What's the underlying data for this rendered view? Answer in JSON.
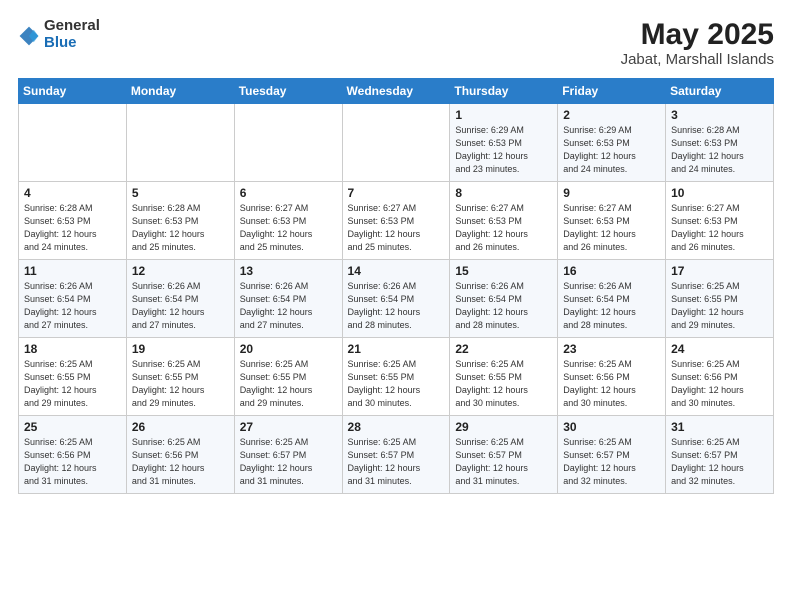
{
  "header": {
    "logo_general": "General",
    "logo_blue": "Blue",
    "month": "May 2025",
    "location": "Jabat, Marshall Islands"
  },
  "weekdays": [
    "Sunday",
    "Monday",
    "Tuesday",
    "Wednesday",
    "Thursday",
    "Friday",
    "Saturday"
  ],
  "weeks": [
    [
      {
        "day": "",
        "info": ""
      },
      {
        "day": "",
        "info": ""
      },
      {
        "day": "",
        "info": ""
      },
      {
        "day": "",
        "info": ""
      },
      {
        "day": "1",
        "info": "Sunrise: 6:29 AM\nSunset: 6:53 PM\nDaylight: 12 hours\nand 23 minutes."
      },
      {
        "day": "2",
        "info": "Sunrise: 6:29 AM\nSunset: 6:53 PM\nDaylight: 12 hours\nand 24 minutes."
      },
      {
        "day": "3",
        "info": "Sunrise: 6:28 AM\nSunset: 6:53 PM\nDaylight: 12 hours\nand 24 minutes."
      }
    ],
    [
      {
        "day": "4",
        "info": "Sunrise: 6:28 AM\nSunset: 6:53 PM\nDaylight: 12 hours\nand 24 minutes."
      },
      {
        "day": "5",
        "info": "Sunrise: 6:28 AM\nSunset: 6:53 PM\nDaylight: 12 hours\nand 25 minutes."
      },
      {
        "day": "6",
        "info": "Sunrise: 6:27 AM\nSunset: 6:53 PM\nDaylight: 12 hours\nand 25 minutes."
      },
      {
        "day": "7",
        "info": "Sunrise: 6:27 AM\nSunset: 6:53 PM\nDaylight: 12 hours\nand 25 minutes."
      },
      {
        "day": "8",
        "info": "Sunrise: 6:27 AM\nSunset: 6:53 PM\nDaylight: 12 hours\nand 26 minutes."
      },
      {
        "day": "9",
        "info": "Sunrise: 6:27 AM\nSunset: 6:53 PM\nDaylight: 12 hours\nand 26 minutes."
      },
      {
        "day": "10",
        "info": "Sunrise: 6:27 AM\nSunset: 6:53 PM\nDaylight: 12 hours\nand 26 minutes."
      }
    ],
    [
      {
        "day": "11",
        "info": "Sunrise: 6:26 AM\nSunset: 6:54 PM\nDaylight: 12 hours\nand 27 minutes."
      },
      {
        "day": "12",
        "info": "Sunrise: 6:26 AM\nSunset: 6:54 PM\nDaylight: 12 hours\nand 27 minutes."
      },
      {
        "day": "13",
        "info": "Sunrise: 6:26 AM\nSunset: 6:54 PM\nDaylight: 12 hours\nand 27 minutes."
      },
      {
        "day": "14",
        "info": "Sunrise: 6:26 AM\nSunset: 6:54 PM\nDaylight: 12 hours\nand 28 minutes."
      },
      {
        "day": "15",
        "info": "Sunrise: 6:26 AM\nSunset: 6:54 PM\nDaylight: 12 hours\nand 28 minutes."
      },
      {
        "day": "16",
        "info": "Sunrise: 6:26 AM\nSunset: 6:54 PM\nDaylight: 12 hours\nand 28 minutes."
      },
      {
        "day": "17",
        "info": "Sunrise: 6:25 AM\nSunset: 6:55 PM\nDaylight: 12 hours\nand 29 minutes."
      }
    ],
    [
      {
        "day": "18",
        "info": "Sunrise: 6:25 AM\nSunset: 6:55 PM\nDaylight: 12 hours\nand 29 minutes."
      },
      {
        "day": "19",
        "info": "Sunrise: 6:25 AM\nSunset: 6:55 PM\nDaylight: 12 hours\nand 29 minutes."
      },
      {
        "day": "20",
        "info": "Sunrise: 6:25 AM\nSunset: 6:55 PM\nDaylight: 12 hours\nand 29 minutes."
      },
      {
        "day": "21",
        "info": "Sunrise: 6:25 AM\nSunset: 6:55 PM\nDaylight: 12 hours\nand 30 minutes."
      },
      {
        "day": "22",
        "info": "Sunrise: 6:25 AM\nSunset: 6:55 PM\nDaylight: 12 hours\nand 30 minutes."
      },
      {
        "day": "23",
        "info": "Sunrise: 6:25 AM\nSunset: 6:56 PM\nDaylight: 12 hours\nand 30 minutes."
      },
      {
        "day": "24",
        "info": "Sunrise: 6:25 AM\nSunset: 6:56 PM\nDaylight: 12 hours\nand 30 minutes."
      }
    ],
    [
      {
        "day": "25",
        "info": "Sunrise: 6:25 AM\nSunset: 6:56 PM\nDaylight: 12 hours\nand 31 minutes."
      },
      {
        "day": "26",
        "info": "Sunrise: 6:25 AM\nSunset: 6:56 PM\nDaylight: 12 hours\nand 31 minutes."
      },
      {
        "day": "27",
        "info": "Sunrise: 6:25 AM\nSunset: 6:57 PM\nDaylight: 12 hours\nand 31 minutes."
      },
      {
        "day": "28",
        "info": "Sunrise: 6:25 AM\nSunset: 6:57 PM\nDaylight: 12 hours\nand 31 minutes."
      },
      {
        "day": "29",
        "info": "Sunrise: 6:25 AM\nSunset: 6:57 PM\nDaylight: 12 hours\nand 31 minutes."
      },
      {
        "day": "30",
        "info": "Sunrise: 6:25 AM\nSunset: 6:57 PM\nDaylight: 12 hours\nand 32 minutes."
      },
      {
        "day": "31",
        "info": "Sunrise: 6:25 AM\nSunset: 6:57 PM\nDaylight: 12 hours\nand 32 minutes."
      }
    ]
  ]
}
